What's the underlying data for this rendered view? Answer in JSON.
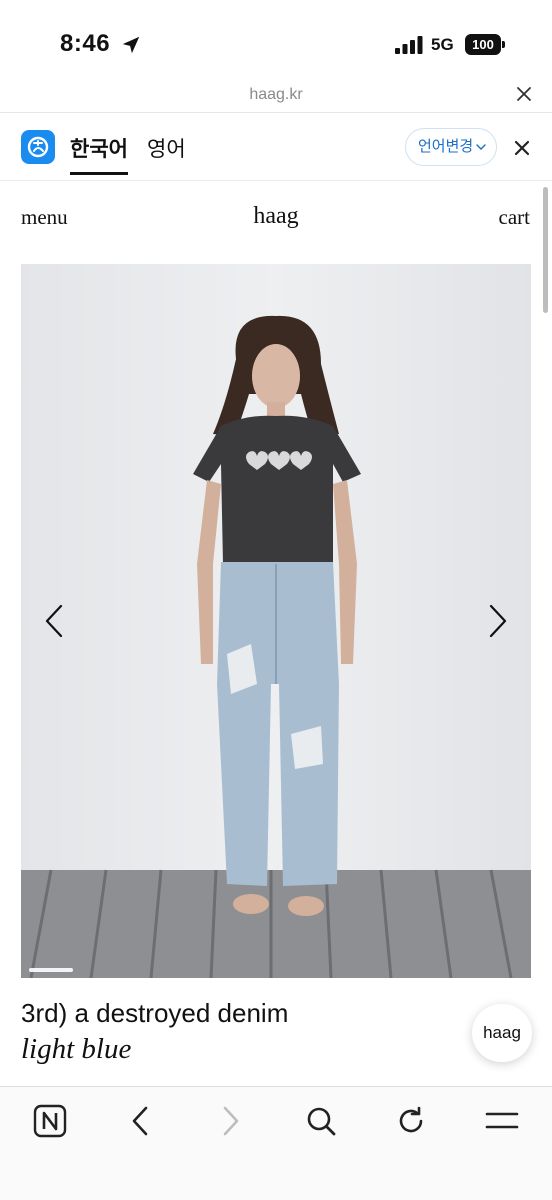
{
  "status_bar": {
    "time": "8:46",
    "network": "5G",
    "battery": "100"
  },
  "url_bar": {
    "domain": "haag.kr"
  },
  "translate_bar": {
    "tab_korean": "한국어",
    "tab_english": "영어",
    "change_language_label": "언어변경"
  },
  "site_header": {
    "menu_label": "menu",
    "logo": "haag",
    "cart_label": "cart"
  },
  "product": {
    "name": "3rd) a destroyed denim",
    "color": "light blue"
  },
  "chat": {
    "label": "haag"
  },
  "colors": {
    "translate_logo": "#1a8cf0",
    "lang_change_text": "#1a6fc9",
    "background": "#ffffff"
  },
  "toolbar": {
    "icons": [
      "naver-home-icon",
      "back-icon",
      "forward-icon",
      "search-icon",
      "refresh-icon",
      "menu-icon"
    ]
  }
}
